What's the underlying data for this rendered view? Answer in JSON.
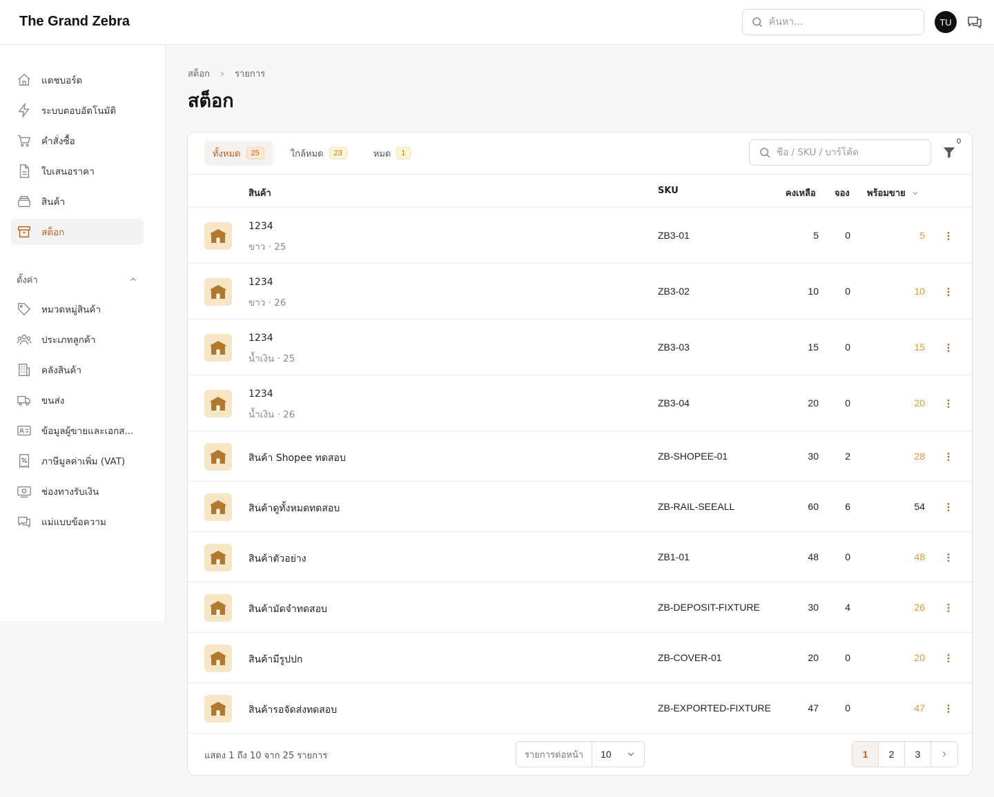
{
  "app": {
    "brand": "The Grand Zebra"
  },
  "topbar": {
    "search_placeholder": "ค้นหา...",
    "avatar_initials": "TU"
  },
  "sidebar": {
    "items": [
      {
        "label": "แดชบอร์ด",
        "icon": "home-icon",
        "active": false
      },
      {
        "label": "ระบบตอบอัตโนมัติ",
        "icon": "bolt-icon",
        "active": false
      },
      {
        "label": "คำสั่งซื้อ",
        "icon": "cart-icon",
        "active": false
      },
      {
        "label": "ใบเสนอราคา",
        "icon": "document-icon",
        "active": false
      },
      {
        "label": "สินค้า",
        "icon": "box-stack-icon",
        "active": false
      },
      {
        "label": "สต็อก",
        "icon": "archive-icon",
        "active": true
      }
    ],
    "settings_label": "ตั้งค่า",
    "settings_items": [
      {
        "label": "หมวดหมู่สินค้า",
        "icon": "tag-icon"
      },
      {
        "label": "ประเภทลูกค้า",
        "icon": "users-icon"
      },
      {
        "label": "คลังสินค้า",
        "icon": "building-icon"
      },
      {
        "label": "ขนส่ง",
        "icon": "truck-icon"
      },
      {
        "label": "ข้อมูลผู้ขายและเอกส...",
        "icon": "id-card-icon"
      },
      {
        "label": "ภาษีมูลค่าเพิ่ม (VAT)",
        "icon": "receipt-percent-icon"
      },
      {
        "label": "ช่องทางรับเงิน",
        "icon": "cash-icon"
      },
      {
        "label": "แม่แบบข้อความ",
        "icon": "chat-icon"
      }
    ]
  },
  "breadcrumb": {
    "root": "สต็อก",
    "current": "รายการ"
  },
  "page": {
    "title": "สต็อก"
  },
  "tabs": [
    {
      "label": "ทั้งหมด",
      "count": "25",
      "active": true
    },
    {
      "label": "ใกล้หมด",
      "count": "23",
      "active": false
    },
    {
      "label": "หมด",
      "count": "1",
      "active": false
    }
  ],
  "list_search": {
    "placeholder": "ชื่อ / SKU / บาร์โค้ด"
  },
  "filter": {
    "count": "0"
  },
  "table": {
    "headers": {
      "product": "สินค้า",
      "sku": "SKU",
      "on_hand": "คงเหลือ",
      "reserved": "จอง",
      "available": "พร้อมขาย"
    },
    "rows": [
      {
        "name": "1234",
        "variant": "ขาว · 25",
        "sku": "ZB3-01",
        "on_hand": "5",
        "reserved": "0",
        "available": "5",
        "low": true
      },
      {
        "name": "1234",
        "variant": "ขาว · 26",
        "sku": "ZB3-02",
        "on_hand": "10",
        "reserved": "0",
        "available": "10",
        "low": true
      },
      {
        "name": "1234",
        "variant": "น้ำเงิน · 25",
        "sku": "ZB3-03",
        "on_hand": "15",
        "reserved": "0",
        "available": "15",
        "low": true
      },
      {
        "name": "1234",
        "variant": "น้ำเงิน · 26",
        "sku": "ZB3-04",
        "on_hand": "20",
        "reserved": "0",
        "available": "20",
        "low": true
      },
      {
        "name": "สินค้า Shopee ทดสอบ",
        "variant": "",
        "sku": "ZB-SHOPEE-01",
        "on_hand": "30",
        "reserved": "2",
        "available": "28",
        "low": true
      },
      {
        "name": "สินค้าดูทั้งหมดทดสอบ",
        "variant": "",
        "sku": "ZB-RAIL-SEEALL",
        "on_hand": "60",
        "reserved": "6",
        "available": "54",
        "low": false
      },
      {
        "name": "สินค้าตัวอย่าง",
        "variant": "",
        "sku": "ZB1-01",
        "on_hand": "48",
        "reserved": "0",
        "available": "48",
        "low": true
      },
      {
        "name": "สินค้ามัดจำทดสอบ",
        "variant": "",
        "sku": "ZB-DEPOSIT-FIXTURE",
        "on_hand": "30",
        "reserved": "4",
        "available": "26",
        "low": true
      },
      {
        "name": "สินค้ามีรูปปก",
        "variant": "",
        "sku": "ZB-COVER-01",
        "on_hand": "20",
        "reserved": "0",
        "available": "20",
        "low": true
      },
      {
        "name": "สินค้ารอจัดส่งทดสอบ",
        "variant": "",
        "sku": "ZB-EXPORTED-FIXTURE",
        "on_hand": "47",
        "reserved": "0",
        "available": "47",
        "low": true
      }
    ]
  },
  "footer": {
    "showing": "แสดง 1 ถึง 10 จาก 25 รายการ",
    "per_page_label": "รายการต่อหน้า",
    "per_page_value": "10",
    "pages": [
      "1",
      "2",
      "3"
    ],
    "current_page": "1"
  },
  "colors": {
    "accent": "#c0621a",
    "low_stock": "#e09a3a",
    "thumb_bg": "#f6e6c6",
    "thumb_icon": "#b07a2e"
  }
}
